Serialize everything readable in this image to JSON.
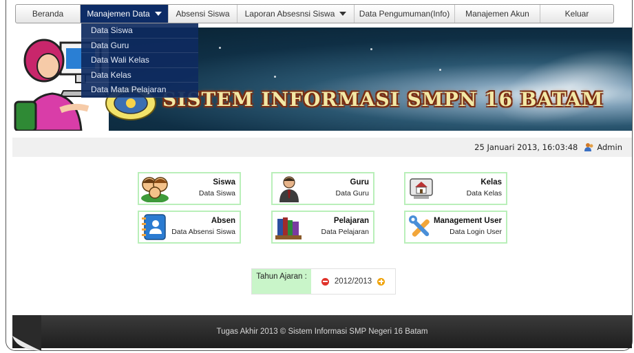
{
  "nav": {
    "items": [
      {
        "label": "Beranda"
      },
      {
        "label": "Manajemen Data"
      },
      {
        "label": "Absensi Siswa"
      },
      {
        "label": "Laporan Absesnsi Siswa"
      },
      {
        "label": "Data Pengumuman(Info)"
      },
      {
        "label": "Manajemen Akun"
      },
      {
        "label": "Keluar"
      }
    ],
    "dropdown": [
      "Data Siswa",
      "Data Guru",
      "Data Wali Kelas",
      "Data Kelas",
      "Data Mata Pelajaran"
    ]
  },
  "banner": {
    "title": "SISTEM INFORMASI SMPN 16 BATAM"
  },
  "infobar": {
    "datetime": "25 Januari 2013, 16:03:48",
    "user": "Admin"
  },
  "tiles": [
    {
      "title": "Siswa",
      "subtitle": "Data Siswa",
      "icon": "students-icon"
    },
    {
      "title": "Guru",
      "subtitle": "Data Guru",
      "icon": "teacher-icon"
    },
    {
      "title": "Kelas",
      "subtitle": "Data Kelas",
      "icon": "classroom-icon"
    },
    {
      "title": "Absen",
      "subtitle": "Data Absensi Siswa",
      "icon": "attendance-book-icon"
    },
    {
      "title": "Pelajaran",
      "subtitle": "Data Pelajaran",
      "icon": "books-icon"
    },
    {
      "title": "Management User",
      "subtitle": "Data Login User",
      "icon": "tools-icon"
    }
  ],
  "year": {
    "label": "Tahun Ajaran :",
    "value": "2012/2013"
  },
  "footer": {
    "text": "Tugas Akhir 2013 © Sistem Informasi SMP Negeri 16 Batam"
  },
  "colors": {
    "nav_active": "#0d2c66",
    "tile_border": "#b9efb9",
    "year_label_bg": "#c9f5c9",
    "footer_bg": "#2a2a2a"
  }
}
